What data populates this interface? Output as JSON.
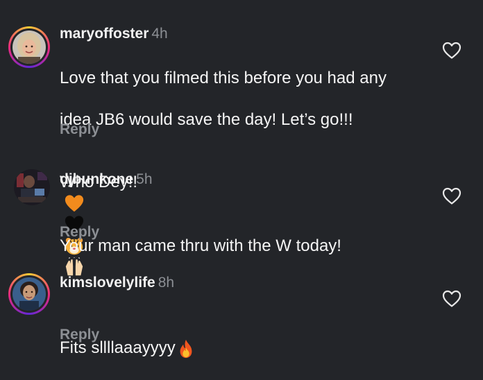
{
  "comments": [
    {
      "username": "maryoffoster",
      "time": "4h",
      "text_line1": "Love that you filmed this before you had any",
      "text_line2": "idea JB6 would save the day!  Let’s go!!!",
      "text_line3": "Who Dey!!",
      "emojis": [
        "orange-heart",
        "black-heart",
        "tiger-face"
      ],
      "reply_label": "Reply",
      "has_story_ring": true,
      "liked": false
    },
    {
      "username": "djbunkone",
      "time": "5h",
      "text_line1": "Your man came thru with the W today!",
      "emojis": [
        "raising-hands"
      ],
      "reply_label": "Reply",
      "has_story_ring": false,
      "liked": false
    },
    {
      "username": "kimslovelylife",
      "time": "8h",
      "text_line1": "Fits sllllaaayyyy",
      "emojis": [
        "fire"
      ],
      "reply_label": "Reply",
      "has_story_ring": true,
      "liked": false
    }
  ],
  "colors": {
    "background": "#232529",
    "text": "#f5f5f5",
    "muted": "#8c8f94"
  }
}
